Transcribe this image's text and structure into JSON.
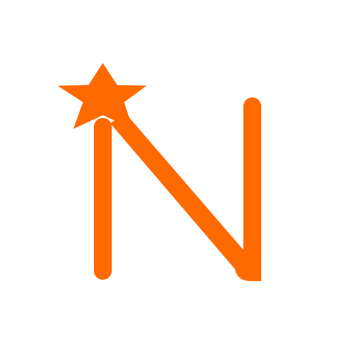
{
  "logo": {
    "letter": "N",
    "icon": "star-n-logo-icon",
    "color": "#ff6a00",
    "background": "#ffffff"
  }
}
